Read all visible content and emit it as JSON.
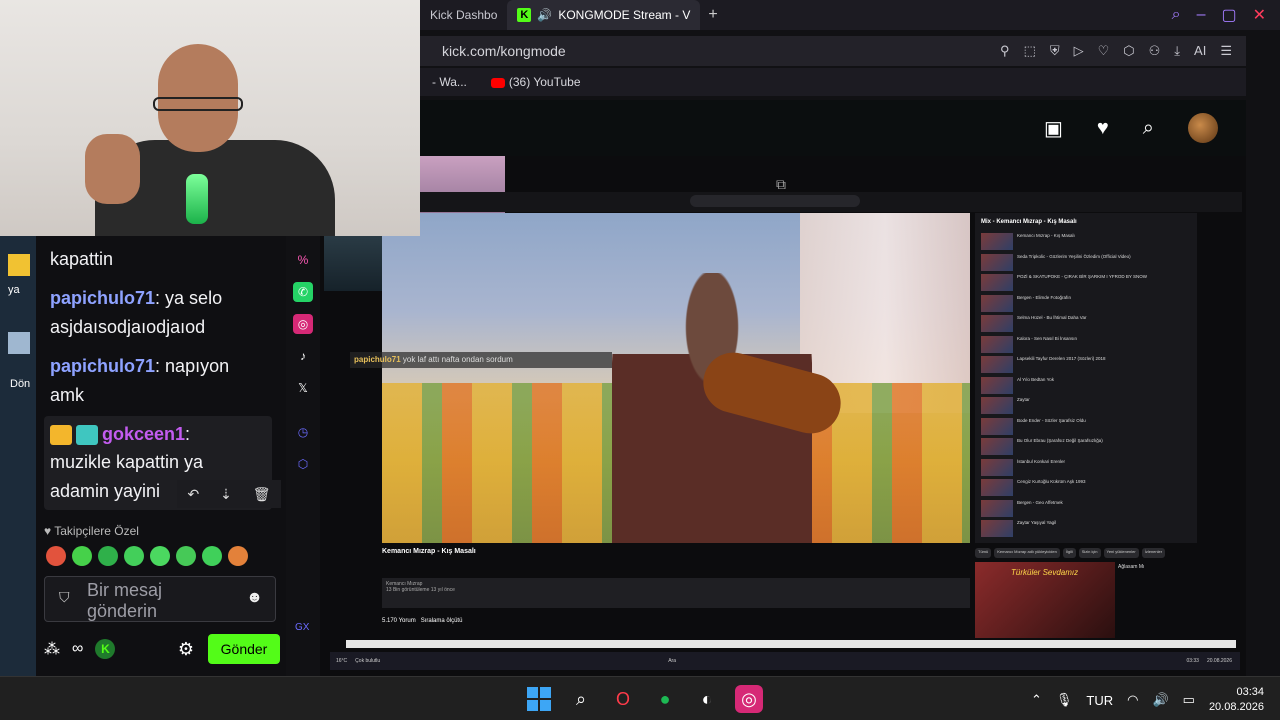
{
  "browser": {
    "tabs": [
      {
        "label": "Kick Dashbo",
        "active": false
      },
      {
        "label": "KONGMODE Stream - V",
        "active": true
      }
    ],
    "address": "kick.com/kongmode",
    "bookmarks": [
      {
        "label": "- Wa..."
      },
      {
        "label": "(36) YouTube"
      }
    ],
    "ai_label": "AI"
  },
  "stream": {
    "overlay_chat_user": "papichulo71",
    "overlay_chat_text": "yok laf attı nafta ondan sordum",
    "video_title": "Kemancı Mızrap - Kış Masalı",
    "channel_name": "Kemancı Mızrap",
    "meta_line": "13 Bin görüntüleme  13 yıl önce",
    "comments_count": "5.170 Yorum",
    "sort_label": "Sıralama ölçütü",
    "sidebar_title": "Mix - Kemancı Mızrap - Kış Masalı",
    "sidebar_items": [
      "Kemancı Mızrap - Kış Masalı",
      "Seda Tripkolic - Gözlerim Yeşilini Özledim (Official Video)",
      "POZİ & SKATUPOKE - ÇIRAK BİR ŞARKIM I YFROD BY SNOW",
      "Bergen - Elimde Fotoğrafın",
      "Selma Hüzel - Bu İhtimal Daha Var",
      "Kalora - Sen Nasıl Bi İnsansın",
      "Lapsekili Tayfur Derelen 2017 (Sözleri) 2018",
      "Al Yılo Bedtan Yok",
      "Zaytar",
      "Bode Ender - Sözler Şarafsiz Oldu",
      "Bu Olur Ebrau (Şarafsız Değil Şarafsızlığa)",
      "İstanbul Konkari Erenler",
      "Cengiz Kurtoğlu Kükrüm Aşk 1993",
      "Bergen - Geo Affetmek",
      "Zaytar Yaşıyal Yagil"
    ],
    "chips": [
      "Tümü",
      "Kemancı Mızrap adlı yükleyiciden",
      "İlgili",
      "Sizin için",
      "Yeni yüklenenler",
      "İzlenenler"
    ],
    "album_text": "Türküler Sevdamız",
    "album_info_title": "Ağlasam Mı",
    "inner_tray_temp": "16°C",
    "inner_tray_weather": "Çok bulutlu",
    "inner_search": "Ara",
    "inner_clock_time": "03:33",
    "inner_clock_date": "20.08.2026"
  },
  "chat": {
    "lines": [
      {
        "user": "",
        "text": "kapattin"
      },
      {
        "user": "papichulo71",
        "text": " ya selo"
      },
      {
        "user": "",
        "text": "asjdaısodjaıodjaıod"
      },
      {
        "user": "papichulo71",
        "text": " napıyon"
      },
      {
        "user": "",
        "text": "amk"
      }
    ],
    "highlight_user": "gokceen1",
    "highlight_text_1": "muzikle kapattin ya",
    "highlight_text_2": "adamin yayini",
    "followers_label": "Takipçilere Özel",
    "input_placeholder": "Bir mesaj gönderin",
    "send_label": "Gönder",
    "gx_label": "GX"
  },
  "desktop": {
    "left_label_1": "ya",
    "left_label_2": "Dön"
  },
  "taskbar": {
    "lang": "TUR",
    "time": "03:34",
    "date": "20.08.2026"
  },
  "colors": {
    "kick_green": "#53fc18",
    "username_blue": "#8ea2ff",
    "username_purple": "#c35cf0"
  }
}
